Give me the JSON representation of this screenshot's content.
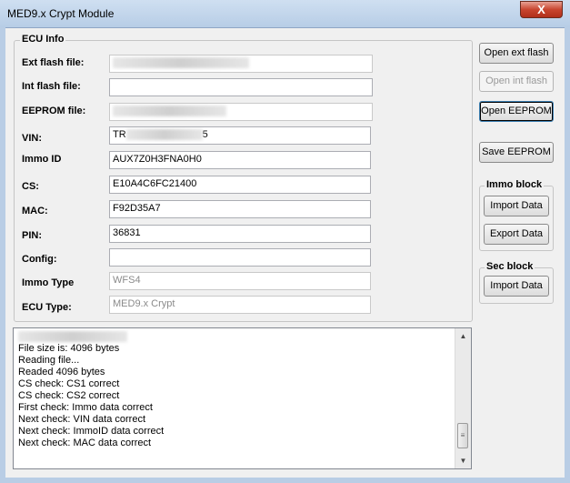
{
  "window": {
    "title": "MED9.x Crypt Module",
    "close_glyph": "X"
  },
  "ecu_info": {
    "title": "ECU Info",
    "fields": {
      "ext_flash": {
        "label": "Ext flash file:",
        "value": ""
      },
      "int_flash": {
        "label": "Int flash file:",
        "value": ""
      },
      "eeprom": {
        "label": "EEPROM file:",
        "value": ""
      },
      "vin": {
        "label": "VIN:",
        "prefix": "TR",
        "suffix": "5"
      },
      "immo_id": {
        "label": "Immo ID",
        "value": "AUX7Z0H3FNA0H0"
      },
      "cs": {
        "label": "CS:",
        "value": "E10A4C6FC21400"
      },
      "mac": {
        "label": "MAC:",
        "value": "F92D35A7"
      },
      "pin": {
        "label": "PIN:",
        "value": "36831"
      },
      "config": {
        "label": "Config:",
        "value": ""
      },
      "immo_type": {
        "label": "Immo Type",
        "value": "WFS4"
      },
      "ecu_type": {
        "label": "ECU Type:",
        "value": "MED9.x Crypt"
      }
    }
  },
  "buttons": {
    "open_ext_flash": "Open ext flash",
    "open_int_flash": "Open int flash",
    "open_eeprom": "Open EEPROM",
    "save_eeprom": "Save EEPROM"
  },
  "immo_block": {
    "title": "Immo block",
    "import": "Import Data",
    "export": "Export Data"
  },
  "sec_block": {
    "title": "Sec block",
    "import": "Import Data"
  },
  "log": {
    "lines": [
      "File size is: 4096 bytes",
      "Reading file...",
      "Readed 4096 bytes",
      "CS check: CS1 correct",
      "CS check: CS2 correct",
      "First check: Immo data correct",
      "Next check: VIN data correct",
      "Next check: ImmoID data correct",
      "Next check: MAC data correct"
    ]
  },
  "colors": {
    "titlebar": "#b7cde6",
    "close_button": "#c8452f",
    "focus_border": "#3c7fb1"
  }
}
